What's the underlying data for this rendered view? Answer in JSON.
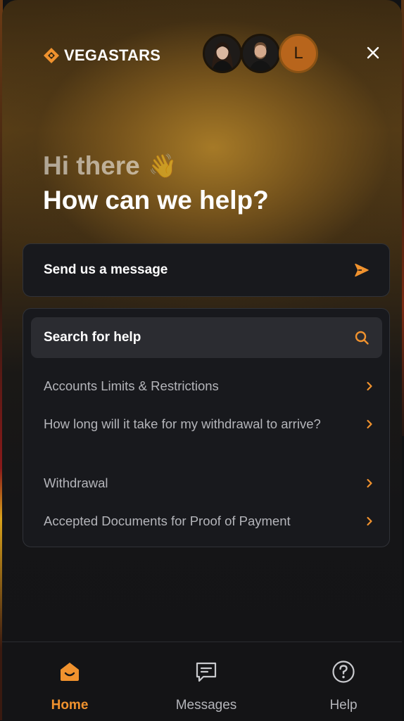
{
  "brand": {
    "name": "VEGASTARS",
    "accent": "#f0922e"
  },
  "header": {
    "avatars": [
      {
        "name": "agent-avatar-1"
      },
      {
        "name": "agent-avatar-2"
      },
      {
        "letter": "L"
      }
    ]
  },
  "greeting": {
    "line1": "Hi there",
    "emoji": "👋",
    "line2": "How can we help?"
  },
  "send_message": {
    "label": "Send us a message",
    "icon": "send-arrow-icon"
  },
  "search": {
    "label": "Search for help",
    "icon": "search-icon"
  },
  "articles": [
    {
      "title": "Accounts Limits & Restrictions"
    },
    {
      "title": "How long will it take for my withdrawal to arrive?"
    },
    {
      "title": "Withdrawal"
    },
    {
      "title": "Accepted Documents for Proof of Payment"
    }
  ],
  "nav": {
    "home": {
      "label": "Home",
      "icon": "home-icon",
      "active": true
    },
    "messages": {
      "label": "Messages",
      "icon": "messages-icon"
    },
    "help": {
      "label": "Help",
      "icon": "help-icon"
    }
  }
}
